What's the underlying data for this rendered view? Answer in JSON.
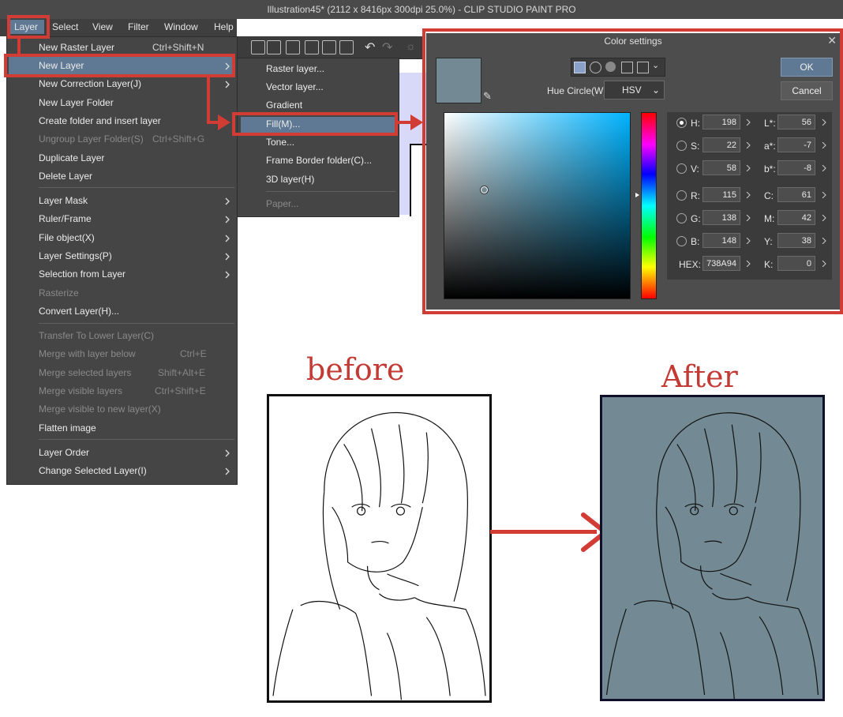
{
  "window": {
    "title": "Illustration45* (2112 x 8416px 300dpi 25.0%)  - CLIP STUDIO PAINT PRO"
  },
  "menubar": [
    "Layer",
    "Select",
    "View",
    "Filter",
    "Window",
    "Help"
  ],
  "layer_menu": {
    "items": [
      {
        "label": "New Raster Layer",
        "shortcut": "Ctrl+Shift+N"
      },
      {
        "label": "New Layer"
      },
      {
        "label": "New Correction Layer(J)"
      },
      {
        "label": "New Layer Folder"
      },
      {
        "label": "Create folder and insert layer"
      },
      {
        "label": "Ungroup Layer Folder(S)",
        "shortcut": "Ctrl+Shift+G"
      },
      {
        "label": "Duplicate Layer"
      },
      {
        "label": "Delete Layer"
      },
      {
        "label": "Layer Mask"
      },
      {
        "label": "Ruler/Frame"
      },
      {
        "label": "File object(X)"
      },
      {
        "label": "Layer Settings(P)"
      },
      {
        "label": "Selection from Layer"
      },
      {
        "label": "Rasterize"
      },
      {
        "label": "Convert Layer(H)..."
      },
      {
        "label": "Transfer To Lower Layer(C)"
      },
      {
        "label": "Merge with layer below",
        "shortcut": "Ctrl+E"
      },
      {
        "label": "Merge selected layers",
        "shortcut": "Shift+Alt+E"
      },
      {
        "label": "Merge visible layers",
        "shortcut": "Ctrl+Shift+E"
      },
      {
        "label": "Merge visible to new layer(X)"
      },
      {
        "label": "Flatten image"
      },
      {
        "label": "Layer Order"
      },
      {
        "label": "Change Selected Layer(I)"
      }
    ]
  },
  "new_layer_submenu": [
    "Raster layer...",
    "Vector layer...",
    "Gradient",
    "Fill(M)...",
    "Tone...",
    "Frame Border folder(C)...",
    "3D layer(H)",
    "Paper..."
  ],
  "color_settings": {
    "title": "Color settings",
    "current_color": "#738A94",
    "hue_circle_label": "Hue Circle(W):",
    "hue_circle_value": "HSV",
    "ok": "OK",
    "cancel": "Cancel",
    "H": "198",
    "S": "22",
    "V": "58",
    "R": "115",
    "G": "138",
    "B": "148",
    "HEX": "738A94",
    "Lstar": "56",
    "astar": "-7",
    "bstar": "-8",
    "C": "61",
    "M": "42",
    "Y": "38",
    "K": "0",
    "labels": {
      "H": "H:",
      "S": "S:",
      "V": "V:",
      "R": "R:",
      "G": "G:",
      "B": "B:",
      "HEX": "HEX:",
      "L": "L*:",
      "a": "a*:",
      "b": "b*:",
      "C": "C:",
      "M": "M:",
      "Y": "Y:",
      "K": "K:"
    }
  },
  "annotations": {
    "before": "before",
    "after": "After"
  },
  "colors": {
    "accent_red": "#d13c35",
    "fill_color": "#738A94",
    "highlight": "#5f7893"
  }
}
